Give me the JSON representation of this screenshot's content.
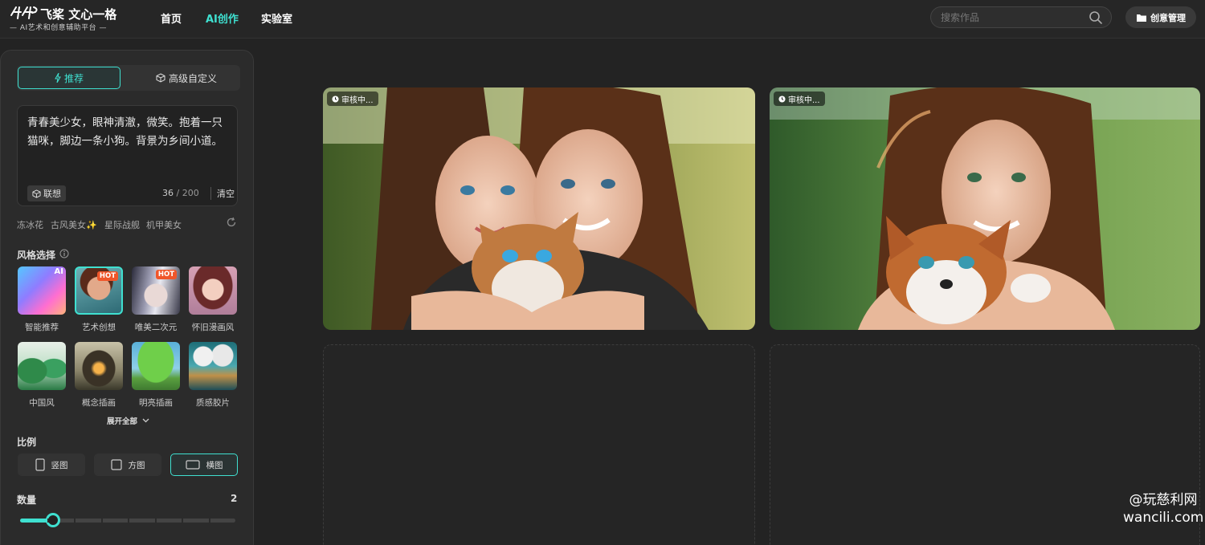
{
  "header": {
    "logo_name": "飞桨 文心一格",
    "logo_sub": "— AI艺术和创意辅助平台 —",
    "nav": [
      {
        "label": "首页",
        "active": false
      },
      {
        "label": "AI创作",
        "active": true
      },
      {
        "label": "实验室",
        "active": false
      }
    ],
    "search_placeholder": "搜索作品",
    "manage_label": "创意管理"
  },
  "panel": {
    "tabs": [
      {
        "label": "推荐",
        "active": true
      },
      {
        "label": "高级自定义",
        "active": false
      }
    ],
    "prompt": {
      "text": "青春美少女，眼神清澈，微笑。抱着一只猫咪，脚边一条小狗。背景为乡间小道。",
      "assoc_label": "联想",
      "count": "36",
      "max": "/ 200",
      "clear_label": "清空"
    },
    "suggestions": [
      "冻冰花",
      "古风美女✨",
      "星际战舰",
      "机甲美女"
    ],
    "style_title": "风格选择",
    "styles": [
      {
        "label": "智能推荐",
        "badge": "AI",
        "selected": false,
        "icon": "gradient-thumb"
      },
      {
        "label": "艺术创想",
        "badge": "HOT",
        "selected": true,
        "icon": "portrait-thumb"
      },
      {
        "label": "唯美二次元",
        "badge": "HOT",
        "selected": false,
        "icon": "anime-thumb"
      },
      {
        "label": "怀旧漫画风",
        "badge": "",
        "selected": false,
        "icon": "retro-anime-thumb"
      },
      {
        "label": "中国风",
        "badge": "",
        "selected": false,
        "icon": "chinese-landscape-thumb"
      },
      {
        "label": "概念插画",
        "badge": "",
        "selected": false,
        "icon": "concept-house-thumb"
      },
      {
        "label": "明亮插画",
        "badge": "",
        "selected": false,
        "icon": "tree-thumb"
      },
      {
        "label": "质感胶片",
        "badge": "",
        "selected": false,
        "icon": "clouds-thumb"
      }
    ],
    "expand_label": "展开全部",
    "ratio_title": "比例",
    "ratios": [
      {
        "label": "竖图",
        "active": false
      },
      {
        "label": "方图",
        "active": false
      },
      {
        "label": "横图",
        "active": true
      }
    ],
    "quantity_title": "数量",
    "quantity_value": "2",
    "quantity_min": 1,
    "quantity_max": 9
  },
  "results": {
    "status_label": "审核中..."
  },
  "watermark": {
    "line1": "@玩慈利网",
    "line2": "wancili.com"
  },
  "colors": {
    "accent": "#3fe0d0",
    "hot": "#f0562a",
    "background": "#232323"
  }
}
